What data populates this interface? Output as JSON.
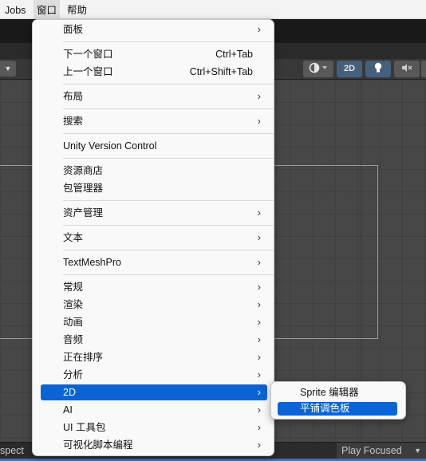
{
  "menubar": {
    "items": [
      {
        "label": "Jobs"
      },
      {
        "label": "窗口"
      },
      {
        "label": "帮助"
      }
    ]
  },
  "toolbar": {
    "btn_2d": "2D"
  },
  "statusbar": {
    "aspect": "spect",
    "play_mode": "Play Focused"
  },
  "window_menu": {
    "items": [
      {
        "label": "面板",
        "submenu": true
      },
      {
        "label": "下一个窗口",
        "shortcut": "Ctrl+Tab"
      },
      {
        "label": "上一个窗口",
        "shortcut": "Ctrl+Shift+Tab"
      },
      {
        "label": "布局",
        "submenu": true
      },
      {
        "label": "搜索",
        "submenu": true
      },
      {
        "label": "Unity Version Control"
      },
      {
        "label": "资源商店"
      },
      {
        "label": "包管理器"
      },
      {
        "label": "资产管理",
        "submenu": true
      },
      {
        "label": "文本",
        "submenu": true
      },
      {
        "label": "TextMeshPro",
        "submenu": true
      },
      {
        "label": "常规",
        "submenu": true
      },
      {
        "label": "渲染",
        "submenu": true
      },
      {
        "label": "动画",
        "submenu": true
      },
      {
        "label": "音频",
        "submenu": true
      },
      {
        "label": "正在排序",
        "submenu": true
      },
      {
        "label": "分析",
        "submenu": true
      },
      {
        "label": "2D",
        "submenu": true,
        "selected": true
      },
      {
        "label": "AI",
        "submenu": true
      },
      {
        "label": "UI 工具包",
        "submenu": true
      },
      {
        "label": "可视化脚本编程",
        "submenu": true
      }
    ],
    "chevron": "›"
  },
  "submenu_2d": {
    "items": [
      {
        "label": "Sprite 编辑器"
      },
      {
        "label": "平铺调色板",
        "selected": true
      }
    ]
  }
}
